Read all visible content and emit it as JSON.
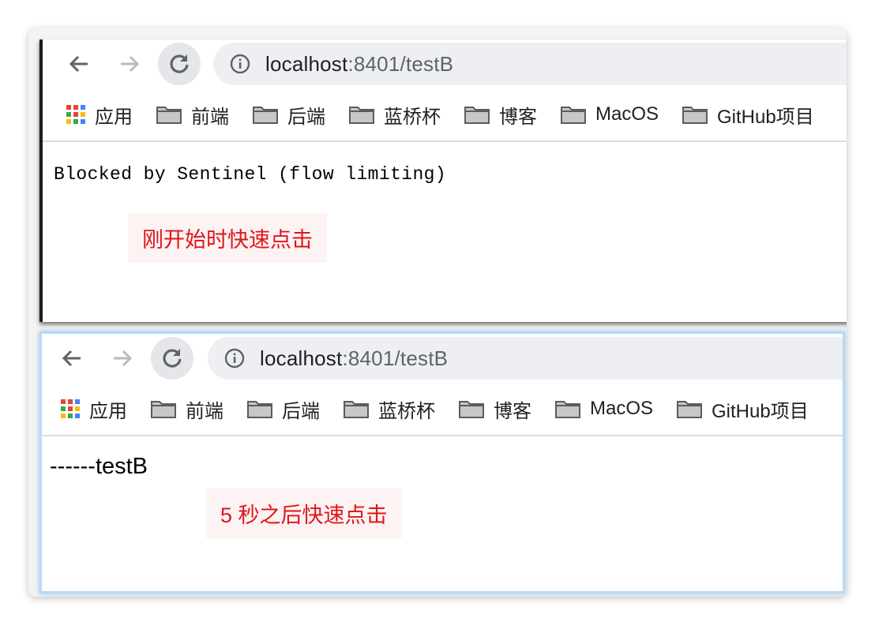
{
  "browser": {
    "url_host": "localhost",
    "url_rest": ":8401/testB",
    "bookmarks": {
      "apps": "应用",
      "folders": [
        "前端",
        "后端",
        "蓝桥杯",
        "博客",
        "MacOS",
        "GitHub项目"
      ]
    }
  },
  "top": {
    "page_text": "Blocked by Sentinel (flow limiting)",
    "annotation": "刚开始时快速点击"
  },
  "bottom": {
    "page_text": "------testB",
    "annotation": "5 秒之后快速点击"
  },
  "icons": [
    "back-arrow-icon",
    "forward-arrow-icon",
    "reload-icon",
    "info-icon",
    "apps-grid-icon",
    "folder-icon"
  ],
  "colors": {
    "annotation": "#e0151b",
    "toolbar": "#edeff2"
  }
}
